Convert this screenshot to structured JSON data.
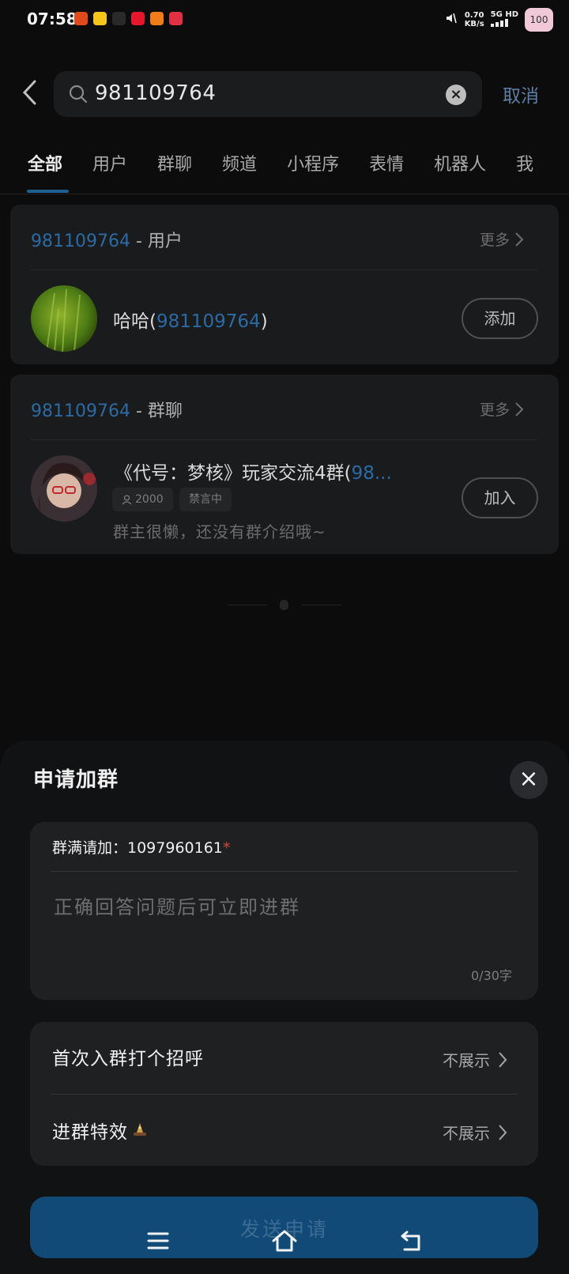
{
  "status_bar": {
    "time": "07:58",
    "app_icons": [
      {
        "name": "app-icon-1",
        "glyph": "",
        "color": "#e04a1a"
      },
      {
        "name": "app-icon-2",
        "glyph": "",
        "color": "#f6c51b"
      },
      {
        "name": "app-icon-3",
        "glyph": "",
        "color": "#2a2a2a"
      },
      {
        "name": "weibo-icon",
        "glyph": "",
        "color": "#e6162d"
      },
      {
        "name": "app-icon-5",
        "glyph": "",
        "color": "#f27d18"
      },
      {
        "name": "app-icon-6",
        "glyph": "",
        "color": "#e03044"
      }
    ],
    "net_speed": "0.70",
    "net_unit": "KB/s",
    "net_type": "5G HD",
    "battery": "100"
  },
  "search": {
    "query": "981109764",
    "cancel_label": "取消"
  },
  "tabs": [
    "全部",
    "用户",
    "群聊",
    "频道",
    "小程序",
    "表情",
    "机器人",
    "我"
  ],
  "user_section": {
    "keyword": "981109764",
    "suffix": " - 用户",
    "more_label": "更多",
    "result": {
      "name": "哈哈(",
      "id": "981109764",
      "close_paren": ")",
      "button_label": "添加"
    }
  },
  "group_section": {
    "keyword": "981109764",
    "suffix": " - 群聊",
    "more_label": "更多",
    "result": {
      "name": "《代号：梦核》玩家交流4群(",
      "id_partial": "98...",
      "member_count": "2000",
      "mute_tag": "禁言中",
      "description": "群主很懒，还没有群介绍哦~",
      "button_label": "加入"
    }
  },
  "sheet": {
    "title": "申请加群",
    "question_label": "群满请加：1097960161",
    "required_mark": "*",
    "answer_placeholder": "正确回答问题后可立即进群",
    "counter": "0/30字",
    "greeting_label": "首次入群打个招呼",
    "greeting_value": "不展示",
    "effect_label": "进群特效",
    "effect_value": "不展示",
    "send_label": "发送申请"
  },
  "colors": {
    "accent_blue": "#2c6aa3",
    "send_button": "#114a76",
    "required": "#d24a3a"
  }
}
